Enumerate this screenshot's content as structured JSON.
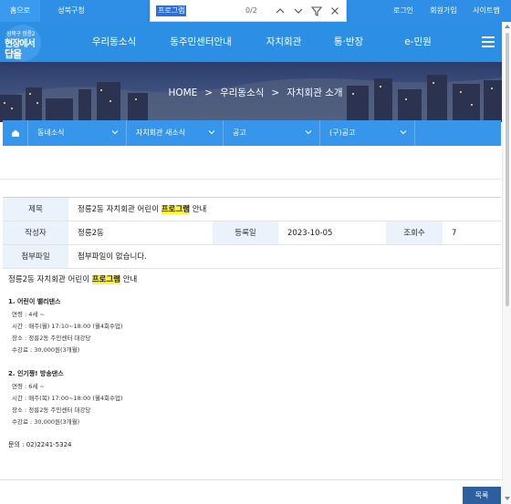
{
  "topbar": {
    "home": "홈으로",
    "site": "성북구청",
    "login": "로그인",
    "join": "회원가입",
    "sitemap": "사이트맵"
  },
  "find": {
    "query": "프로그램",
    "count": "0/2",
    "icons": [
      "chevron-up-icon",
      "chevron-down-icon",
      "filter-icon",
      "close-icon"
    ]
  },
  "logo": {
    "line1": "성북구 정릉2",
    "line2": "현장에서",
    "line3": "답을"
  },
  "nav": [
    "우리동소식",
    "동주민센터안내",
    "자치회관",
    "통·반장",
    "e-민원"
  ],
  "breadcrumb": {
    "home": "HOME",
    "sep": ">",
    "level1": "우리동소식",
    "level2": "자치회관 소개"
  },
  "subnav": {
    "items": [
      "동네소식",
      "자치회관 새소식",
      "공고",
      "(구)공고"
    ]
  },
  "detail": {
    "title_label": "제목",
    "title_before": "정릉2동 자치회관 어린이 ",
    "title_highlight": "프로그램",
    "title_after": " 안내",
    "author_label": "작성자",
    "author": "정릉2동",
    "date_label": "등록일",
    "date": "2023-10-05",
    "views_label": "조회수",
    "views": "7",
    "attach_label": "첨부파일",
    "attach": "첨부파일이 없습니다."
  },
  "content": {
    "title_before": "정릉2동 자치회관 어린이 ",
    "title_highlight": "프로그램",
    "title_after": " 안내",
    "section1": {
      "heading": "1. 어린이 밸리댄스",
      "lines": [
        "연령 : 4세 ~",
        "시간 : 매주(월) 17:10~18:00 (월4회수업)",
        "장소 : 정릉2동 주민센터 대강당",
        "수강료 : 30,000원(3개월)"
      ]
    },
    "section2": {
      "heading": "2. 인기짱! 방송댄스",
      "lines": [
        "연령 : 6세 ~",
        "시간 : 매주(목) 17:00~18:00 (월4회수업)",
        "장소 : 정릉2동 주민센터 대강당",
        "수강료 : 30,000원(3개월)"
      ]
    },
    "contact": "문의 : 02)2241-5324"
  },
  "list_button": "목록",
  "colors": {
    "primary": "#2d8fe3",
    "subnav": "#3796ec",
    "highlight": "#fff23a",
    "list_button": "#2d5f9e"
  }
}
